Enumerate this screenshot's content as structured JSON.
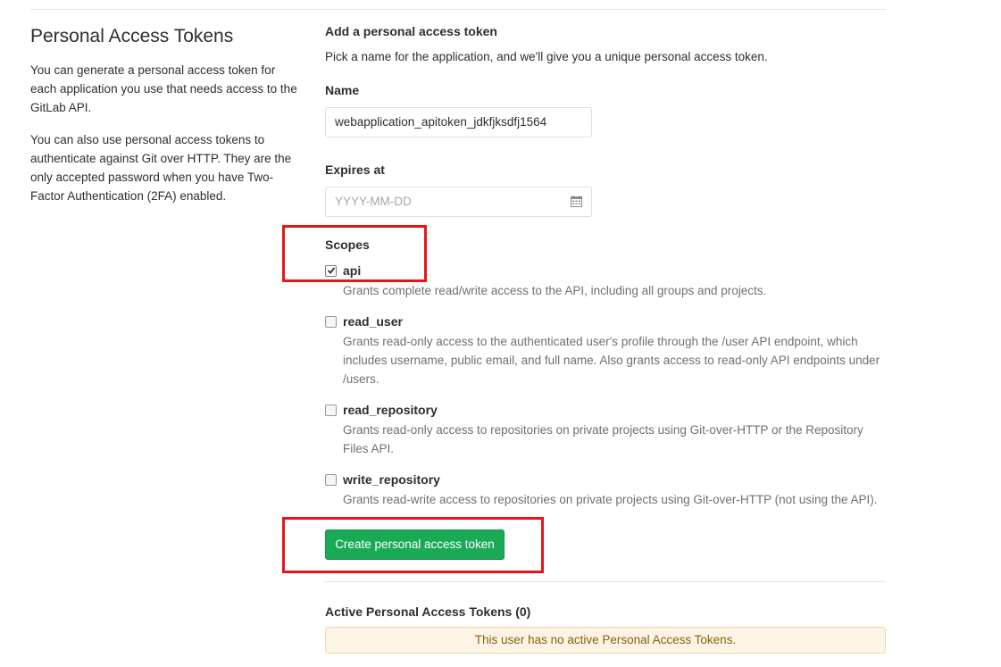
{
  "left": {
    "title": "Personal Access Tokens",
    "paragraph1": "You can generate a personal access token for each application you use that needs access to the GitLab API.",
    "paragraph2": "You can also use personal access tokens to authenticate against Git over HTTP. They are the only accepted password when you have Two-Factor Authentication (2FA) enabled."
  },
  "form": {
    "title": "Add a personal access token",
    "description": "Pick a name for the application, and we'll give you a unique personal access token.",
    "name_label": "Name",
    "name_value": "webapplication_apitoken_jdkfjksdfj1564",
    "expires_label": "Expires at",
    "expires_placeholder": "YYYY-MM-DD",
    "calendar_icon": "calendar-icon",
    "scopes_label": "Scopes",
    "scopes": [
      {
        "name": "api",
        "checked": true,
        "description": "Grants complete read/write access to the API, including all groups and projects."
      },
      {
        "name": "read_user",
        "checked": false,
        "description": "Grants read-only access to the authenticated user's profile through the /user API endpoint, which includes username, public email, and full name. Also grants access to read-only API endpoints under /users."
      },
      {
        "name": "read_repository",
        "checked": false,
        "description": "Grants read-only access to repositories on private projects using Git-over-HTTP or the Repository Files API."
      },
      {
        "name": "write_repository",
        "checked": false,
        "description": "Grants read-write access to repositories on private projects using Git-over-HTTP (not using the API)."
      }
    ],
    "submit_label": "Create personal access token"
  },
  "active": {
    "title": "Active Personal Access Tokens (0)",
    "empty_message": "This user has no active Personal Access Tokens."
  },
  "colors": {
    "button_green": "#1aaa55",
    "highlight_red": "#e8141b",
    "notice_bg": "#fdf4e5"
  }
}
